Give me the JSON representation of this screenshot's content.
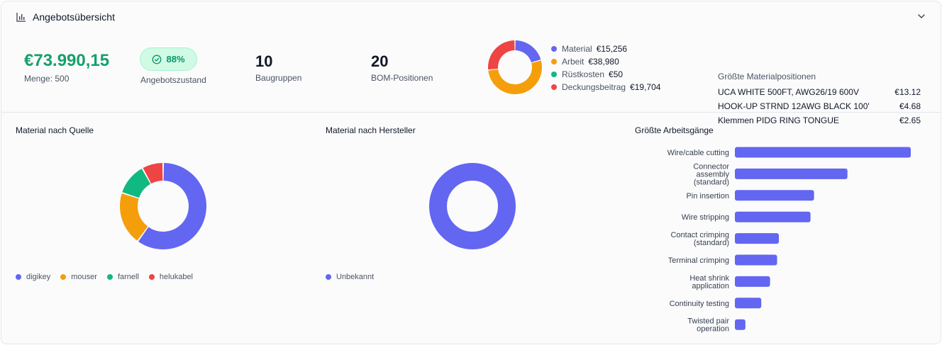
{
  "header": {
    "title": "Angebotsübersicht"
  },
  "summary": {
    "price": "€73.990,15",
    "quantity": "Menge: 500",
    "health": {
      "value": "88%",
      "label": "Angebotszustand"
    },
    "assemblies": {
      "value": "10",
      "label": "Baugruppen"
    },
    "bom": {
      "value": "20",
      "label": "BOM-Positionen"
    }
  },
  "cost_breakdown": [
    {
      "name": "Material",
      "value": "€15,256",
      "amount": 15256,
      "color": "#6366f1"
    },
    {
      "name": "Arbeit",
      "value": "€38,980",
      "amount": 38980,
      "color": "#f59e0b"
    },
    {
      "name": "Rüstkosten",
      "value": "€50",
      "amount": 50,
      "color": "#10b981"
    },
    {
      "name": "Deckungsbeitrag",
      "value": "€19,704",
      "amount": 19704,
      "color": "#ef4444"
    }
  ],
  "materials": {
    "title": "Größte Materialpositionen",
    "rows": [
      {
        "name": "UCA WHITE 500FT, AWG26/19 600V",
        "value": "€13.12"
      },
      {
        "name": "HOOK-UP STRND 12AWG BLACK 100'",
        "value": "€4.68"
      },
      {
        "name": "Klemmen PIDG RING TONGUE",
        "value": "€2.65"
      }
    ]
  },
  "panels": {
    "source_title": "Material nach Quelle",
    "manufacturer_title": "Material nach Hersteller",
    "operations_title": "Größte Arbeitsgänge"
  },
  "chart_data": [
    {
      "type": "pie",
      "title": "Material nach Quelle",
      "categories": [
        "digikey",
        "mouser",
        "farnell",
        "helukabel"
      ],
      "values": [
        60,
        20,
        12,
        8
      ],
      "colors": [
        "#6366f1",
        "#f59e0b",
        "#10b981",
        "#ef4444"
      ],
      "legend": "bottom"
    },
    {
      "type": "pie",
      "title": "Material nach Hersteller",
      "categories": [
        "Unbekannt"
      ],
      "values": [
        100
      ],
      "colors": [
        "#6366f1"
      ],
      "legend": "bottom"
    },
    {
      "type": "bar",
      "orientation": "horizontal",
      "title": "Größte Arbeitsgänge",
      "categories": [
        "Wire/cable cutting",
        "Connector assembly (standard)",
        "Pin insertion",
        "Wire stripping",
        "Contact crimping (standard)",
        "Terminal crimping",
        "Heat shrink application",
        "Continuity testing",
        "Twisted pair operation"
      ],
      "category_lines": [
        [
          "Wire/cable cutting"
        ],
        [
          "Connector",
          "assembly",
          "(standard)"
        ],
        [
          "Pin insertion"
        ],
        [
          "Wire stripping"
        ],
        [
          "Contact crimping",
          "(standard)"
        ],
        [
          "Terminal crimping"
        ],
        [
          "Heat shrink",
          "application"
        ],
        [
          "Continuity testing"
        ],
        [
          "Twisted pair",
          "operation"
        ]
      ],
      "values": [
        100,
        64,
        45,
        43,
        25,
        24,
        20,
        15,
        6
      ],
      "color": "#6366f1",
      "grid": false
    }
  ]
}
